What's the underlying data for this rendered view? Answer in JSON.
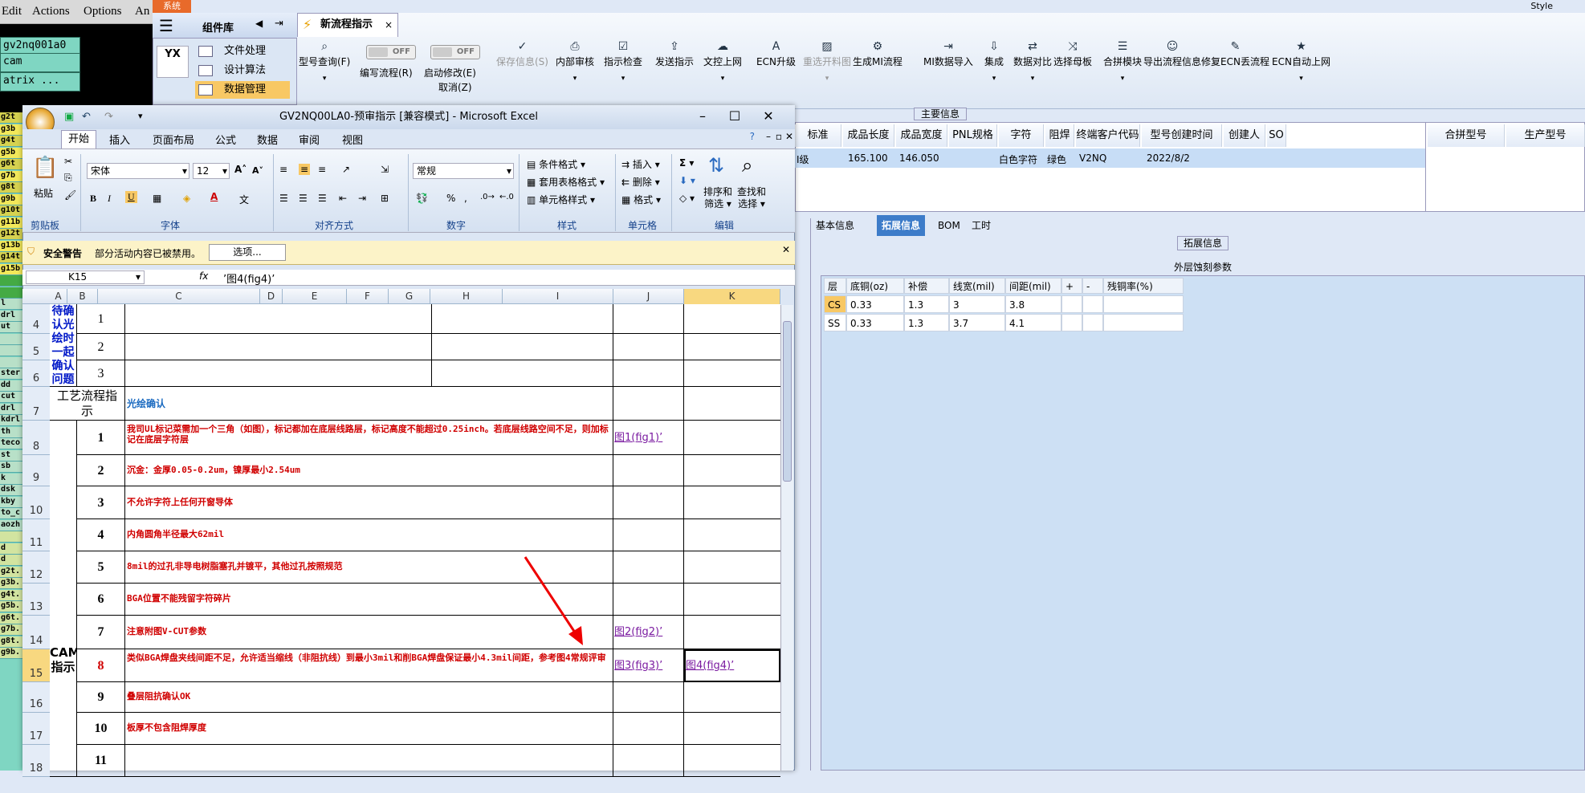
{
  "cam": {
    "menu": [
      "Edit",
      "Actions",
      "Options",
      "An"
    ],
    "boxes": [
      "gv2nq001a0",
      "cam",
      "atrix ..."
    ],
    "layers": [
      "g2t",
      "g3b",
      "g4t",
      "g5b",
      "g6t",
      "g7b",
      "g8t",
      "g9b",
      "g10t",
      "g11b",
      "g12t",
      "g13b",
      "g14t",
      "g15b",
      "",
      "",
      "l",
      "drl",
      "ut",
      "",
      "",
      "",
      "ster",
      "dd",
      "cut",
      "drl",
      "kdrl",
      "th",
      "teco",
      "st",
      "sb",
      "k",
      "dsk",
      "kby",
      "to_c",
      "aozh",
      "",
      "d",
      "d",
      "g2t.",
      "g3b.",
      "g4t.",
      "g5b.",
      "g6t.",
      "g7b.",
      "g8t.",
      "g9b."
    ]
  },
  "app": {
    "sys_tab": "系统",
    "style_label": "Style",
    "nav_header": "组件库",
    "nav_items": [
      "文件处理",
      "设计算法",
      "数据管理"
    ],
    "nav_logo": "YX",
    "doc_tab": "新流程指示",
    "toolbar": [
      {
        "icon": "search-icon",
        "glyph": "⌕",
        "label": "型号查询(F)"
      },
      {
        "icon": "toggle-icon",
        "glyph": "",
        "label": "编写流程(R)",
        "toggle": "OFF"
      },
      {
        "icon": "toggle-icon",
        "glyph": "",
        "label": "启动修改(E)",
        "toggle": "OFF",
        "label2": "取消(Z)"
      },
      {
        "icon": "check-icon",
        "glyph": "✓",
        "label": "保存信息(S)",
        "disabled": true
      },
      {
        "icon": "printer-icon",
        "glyph": "⎙",
        "label": "内部审核"
      },
      {
        "icon": "check-box-icon",
        "glyph": "☑",
        "label": "指示检查"
      },
      {
        "icon": "upload-icon",
        "glyph": "⇪",
        "label": "发送指示"
      },
      {
        "icon": "cloud-upload-icon",
        "glyph": "☁",
        "label": "文控上网"
      },
      {
        "icon": "ecn-icon",
        "glyph": "A",
        "label": "ECN升级"
      },
      {
        "icon": "image-icon",
        "glyph": "▨",
        "label": "重选开料图",
        "disabled": true
      },
      {
        "icon": "gear-icon",
        "glyph": "⚙",
        "label": "生成MI流程"
      },
      {
        "icon": "import-icon",
        "glyph": "⇥",
        "label": "MI数据导入"
      },
      {
        "icon": "download-icon",
        "glyph": "⇩",
        "label": "集成"
      },
      {
        "icon": "compare-icon",
        "glyph": "⇄",
        "label": "数据对比"
      },
      {
        "icon": "shuffle-icon",
        "glyph": "⤨",
        "label": "选择母板"
      },
      {
        "icon": "list-icon",
        "glyph": "☰",
        "label": "合拼模块"
      },
      {
        "icon": "smile-icon",
        "glyph": "☺",
        "label": "导出流程信息"
      },
      {
        "icon": "wrench-icon",
        "glyph": "✎",
        "label": "修复ECN丢流程"
      },
      {
        "icon": "star-icon",
        "glyph": "★",
        "label": "ECN自动上网"
      }
    ],
    "main_info_label": "主要信息",
    "grid_headers": [
      "标准",
      "成品长度",
      "成品宽度",
      "PNL规格",
      "字符",
      "阻焊",
      "终端客户代码",
      "型号创建时间",
      "创建人",
      "SO",
      "合拼型号",
      "生产型号"
    ],
    "grid_row": [
      "I级",
      "165.100",
      "146.050",
      "",
      "白色字符",
      "绿色",
      "V2NQ",
      "2022/8/2",
      "",
      ""
    ],
    "lower_tabs": [
      "基本信息",
      "拓展信息",
      "BOM",
      "工时"
    ],
    "ext_label": "拓展信息",
    "etch_title": "外层蚀刻参数",
    "etch_headers": [
      "层",
      "底铜(oz)",
      "补偿",
      "线宽(mil)",
      "间距(mil)",
      "+",
      "-",
      "残铜率(%)"
    ],
    "etch_rows": [
      [
        "CS",
        "0.33",
        "1.3",
        "3",
        "3.8",
        "",
        "",
        ""
      ],
      [
        "SS",
        "0.33",
        "1.3",
        "3.7",
        "4.1",
        "",
        "",
        ""
      ]
    ]
  },
  "excel": {
    "title": "GV2NQ00LA0-预审指示 [兼容模式] - Microsoft Excel",
    "tabs": [
      "开始",
      "插入",
      "页面布局",
      "公式",
      "数据",
      "审阅",
      "视图"
    ],
    "font_name": "宋体",
    "font_size": "12",
    "number_format": "常规",
    "buttons": {
      "paste": "粘贴",
      "cond_format": "条件格式",
      "table_format": "套用表格格式",
      "cell_style": "单元格样式",
      "insert": "插入",
      "delete": "删除",
      "format": "格式",
      "sort": "排序和\n筛选",
      "find": "查找和\n选择",
      "sort_line1": "排序和",
      "sort_line2": "筛选",
      "find_line1": "查找和",
      "find_line2": "选择"
    },
    "groups": [
      "剪贴板",
      "字体",
      "对齐方式",
      "数字",
      "样式",
      "单元格",
      "编辑"
    ],
    "security_title": "安全警告",
    "security_msg": "部分活动内容已被禁用。",
    "security_btn": "选项...",
    "name_box": "K15",
    "fx": "fx",
    "formula": "’图4(fig4)’",
    "columns": [
      "A",
      "B",
      "C",
      "D",
      "E",
      "F",
      "G",
      "H",
      "I",
      "J",
      "K"
    ],
    "rows": [
      "4",
      "5",
      "6",
      "7",
      "8",
      "9",
      "10",
      "11",
      "12",
      "13",
      "14",
      "15",
      "16",
      "17",
      "18"
    ],
    "a_block1": "待确认光绘时一起确认问题",
    "a_block2": "工艺流程指示",
    "a_block3_l1": "CAM",
    "a_block3_l2": "指示",
    "confirm_nums": [
      "1",
      "2",
      "3"
    ],
    "process_text": "光绘确认",
    "items": [
      {
        "n": "1",
        "text": "我司UL标记菜需加一个三角（如图），标记都加在底层线路层，标记高度不能超过0.25inch。若底层线路空间不足，则加标记在底层字符层",
        "link": "图1(fig1)’"
      },
      {
        "n": "2",
        "text": "沉金：金厚0.05-0.2um，镍厚最小2.54um",
        "link": ""
      },
      {
        "n": "3",
        "text": "不允许字符上任何开窗导体",
        "link": ""
      },
      {
        "n": "4",
        "text": "内角圆角半径最大62mil",
        "link": ""
      },
      {
        "n": "5",
        "text": "8mil的过孔非导电树脂塞孔并镀平，其他过孔按照规范",
        "link": ""
      },
      {
        "n": "6",
        "text": "BGA位置不能残留字符碎片",
        "link": ""
      },
      {
        "n": "7",
        "text": "注意附图V-CUT参数",
        "link": "图2(fig2)’"
      },
      {
        "n": "8",
        "text": "类似BGA焊盘夹线间距不足，允许适当缩线（非阻抗线）到最小3mil和削BGA焊盘保证最小4.3mil间距，参考图4常规评审",
        "link": "图3(fig3)’",
        "link2": "图4(fig4)’"
      },
      {
        "n": "9",
        "text": "叠层阻抗确认OK",
        "link": ""
      },
      {
        "n": "10",
        "text": "板厚不包含阻焊厚度",
        "link": ""
      },
      {
        "n": "11",
        "text": "",
        "link": ""
      }
    ]
  }
}
